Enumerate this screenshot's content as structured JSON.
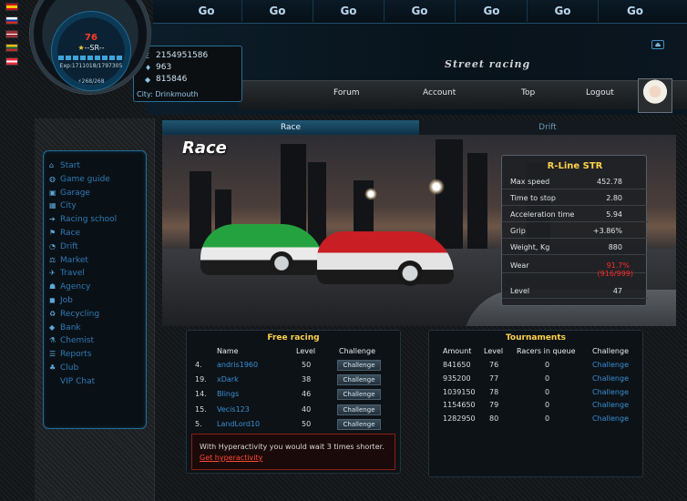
{
  "nav": {
    "go_buttons": [
      "Go",
      "Go",
      "Go",
      "Go",
      "Go",
      "Go",
      "Go"
    ],
    "menu": [
      "Forum",
      "Account",
      "Top",
      "Logout"
    ]
  },
  "logo": {
    "text": "Street racing"
  },
  "player": {
    "level": "76",
    "rank": "--SR--",
    "exp": "Exp:1711018/1797305",
    "energy": "268/268",
    "money": "2154951586",
    "diamonds": "963",
    "points": "815846",
    "city": "City: Drinkmouth"
  },
  "sidebar": {
    "items": [
      {
        "label": "Start",
        "icon": "home-icon"
      },
      {
        "label": "Game guide",
        "icon": "globe-icon"
      },
      {
        "label": "Garage",
        "icon": "garage-icon"
      },
      {
        "label": "City",
        "icon": "city-icon"
      },
      {
        "label": "Racing school",
        "icon": "school-icon"
      },
      {
        "label": "Race",
        "icon": "flag-icon"
      },
      {
        "label": "Drift",
        "icon": "drift-icon"
      },
      {
        "label": "Market",
        "icon": "market-icon"
      },
      {
        "label": "Travel",
        "icon": "travel-icon"
      },
      {
        "label": "Agency",
        "icon": "agency-icon"
      },
      {
        "label": "Job",
        "icon": "job-icon"
      },
      {
        "label": "Recycling",
        "icon": "recycling-icon"
      },
      {
        "label": "Bank",
        "icon": "bank-icon"
      },
      {
        "label": "Chemist",
        "icon": "chemist-icon"
      },
      {
        "label": "Reports",
        "icon": "reports-icon"
      },
      {
        "label": "Club",
        "icon": "club-icon"
      },
      {
        "label": "VIP Chat",
        "icon": ""
      }
    ]
  },
  "tabs": {
    "race": "Race",
    "drift": "Drift"
  },
  "page_title": "Race",
  "car": {
    "name": "R-Line STR",
    "stats": [
      {
        "label": "Max speed",
        "value": "452.78"
      },
      {
        "label": "Time to stop",
        "value": "2.80"
      },
      {
        "label": "Acceleration time",
        "value": "5.94"
      },
      {
        "label": "Grip",
        "value": "+3.86%"
      },
      {
        "label": "Weight, Kg",
        "value": "880"
      },
      {
        "label": "Wear",
        "value": "91.7%",
        "extra": "(916/999)"
      },
      {
        "label": "Level",
        "value": "47"
      }
    ],
    "wear_color": "#ff2a2a"
  },
  "free_racing": {
    "title": "Free racing",
    "headers": [
      "Name",
      "Level",
      "Challenge"
    ],
    "rows": [
      {
        "rank": "4.",
        "name": "andris1960",
        "level": "50",
        "button": "Challenge"
      },
      {
        "rank": "19.",
        "name": "xDark",
        "level": "38",
        "button": "Challenge"
      },
      {
        "rank": "14.",
        "name": "Blings",
        "level": "46",
        "button": "Challenge"
      },
      {
        "rank": "15.",
        "name": "Vecis123",
        "level": "40",
        "button": "Challenge"
      },
      {
        "rank": "5.",
        "name": "LandLord10",
        "level": "50",
        "button": "Challenge"
      }
    ]
  },
  "hyper": {
    "text": "With Hyperactivity you would wait 3 times shorter.",
    "link": "Get hyperactivity"
  },
  "tournaments": {
    "title": "Tournaments",
    "headers": [
      "Amount",
      "Level",
      "Racers in queue",
      "Challenge"
    ],
    "rows": [
      {
        "amount": "841650",
        "level": "76",
        "queue": "0",
        "link": "Challenge"
      },
      {
        "amount": "935200",
        "level": "77",
        "queue": "0",
        "link": "Challenge"
      },
      {
        "amount": "1039150",
        "level": "78",
        "queue": "0",
        "link": "Challenge"
      },
      {
        "amount": "1154650",
        "level": "79",
        "queue": "0",
        "link": "Challenge"
      },
      {
        "amount": "1282950",
        "level": "80",
        "queue": "0",
        "link": "Challenge"
      }
    ]
  },
  "colors": {
    "accent": "#2a6f95",
    "gold": "#ffd24a",
    "link": "#3a8fd6"
  }
}
